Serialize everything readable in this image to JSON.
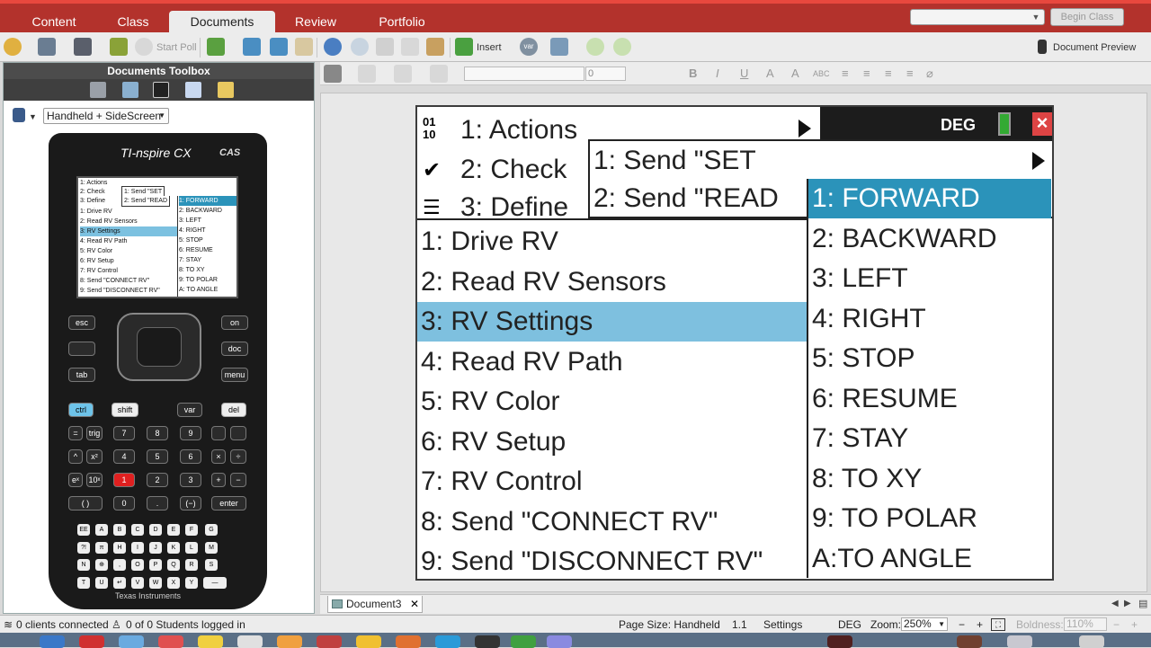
{
  "top_tabs": [
    "Content",
    "Class",
    "Documents",
    "Review",
    "Portfolio"
  ],
  "active_tab": "Documents",
  "begin_class": "Begin Class",
  "toolbar": {
    "start_poll": "Start Poll",
    "insert": "Insert",
    "var": "var",
    "document_preview": "Document Preview"
  },
  "toolbox": {
    "title": "Documents Toolbox",
    "view_select": "Handheld + SideScreen"
  },
  "handheld": {
    "logo": "TI-nspire CX",
    "cas": "CAS",
    "brand": "Texas Instruments",
    "mini_menu": [
      "1: Actions",
      "2: Check",
      "3: Define",
      "1: Drive RV",
      "2: Read RV Sensors",
      "3: RV Settings",
      "4: Read RV Path",
      "5: RV Color",
      "6: RV Setup",
      "7: RV Control",
      "8: Send \"CONNECT RV\"",
      "9: Send \"DISCONNECT RV\""
    ],
    "mini_send": [
      "1: Send \"SET",
      "2: Send \"READ"
    ],
    "mini_sub": [
      "1: FORWARD",
      "2: BACKWARD",
      "3: LEFT",
      "4: RIGHT",
      "5: STOP",
      "6: RESUME",
      "7: STAY",
      "8: TO XY",
      "9: TO POLAR",
      "A: TO ANGLE"
    ],
    "keys": {
      "esc": "esc",
      "on": "on",
      "doc": "doc",
      "menu": "menu",
      "tab": "tab",
      "ctrl": "ctrl",
      "shift": "shift",
      "var": "var",
      "del": "del",
      "eq": "=",
      "trig": "trig",
      "n7": "7",
      "n8": "8",
      "n9": "9",
      "caret": "^",
      "x2": "x²",
      "n4": "4",
      "n5": "5",
      "n6": "6",
      "times": "×",
      "div": "÷",
      "ex": "eˣ",
      "tenx": "10ˣ",
      "n1": "1",
      "n2": "2",
      "n3": "3",
      "plus": "+",
      "minus": "−",
      "paren": "( )",
      "n0": "0",
      "dot": ".",
      "neg": "(−)",
      "enter": "enter",
      "letters": [
        "EE",
        "A",
        "B",
        "C",
        "D",
        "E",
        "F",
        "G",
        "?!",
        "π",
        "H",
        "I",
        "J",
        "K",
        "L",
        "M",
        "N",
        "⊕",
        ",",
        "O",
        "P",
        "Q",
        "R",
        "S",
        "T",
        "U",
        "↵",
        "V",
        "W",
        "X",
        "Y",
        "Z",
        "—"
      ]
    }
  },
  "screen": {
    "actions": "1: Actions",
    "check": "2: Check",
    "define": "3: Define",
    "send_set": "1: Send \"SET",
    "send_read": "2: Send \"READ",
    "deg": "DEG",
    "close": "×",
    "main_items": [
      "1: Drive RV",
      "2: Read RV Sensors",
      "3: RV Settings",
      "4: Read RV Path",
      "5: RV Color",
      "6: RV Setup",
      "7: RV Control",
      "8: Send \"CONNECT RV\"",
      "9: Send \"DISCONNECT RV\""
    ],
    "sub_items": [
      "1: FORWARD",
      "2: BACKWARD",
      "3: LEFT",
      "4: RIGHT",
      "5: STOP",
      "6: RESUME",
      "7: STAY",
      "8: TO XY",
      "9: TO POLAR",
      "A:TO ANGLE"
    ]
  },
  "format_bar": {
    "size": "0"
  },
  "doc_tab": "Document3",
  "status": {
    "clients": "0 clients connected",
    "students": "0 of 0 Students logged in",
    "page_size": "Page Size: Handheld",
    "page_num": "1.1",
    "page_name": "Settings",
    "mode": "DEG",
    "zoom_label": "Zoom:",
    "zoom_value": "250%",
    "boldness_label": "Boldness:",
    "boldness_value": "110%"
  }
}
